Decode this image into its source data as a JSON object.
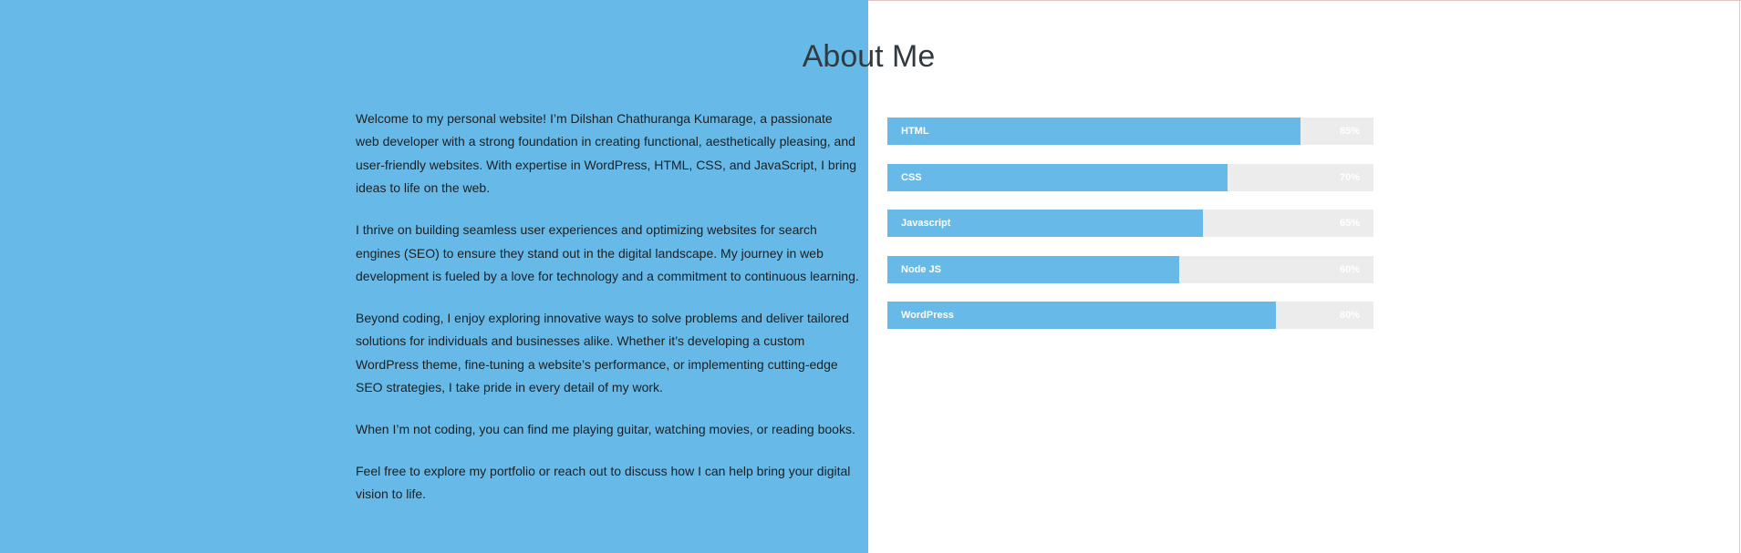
{
  "section": {
    "title": "About Me"
  },
  "bio": {
    "paragraphs": [
      "Welcome to my personal website! I’m Dilshan Chathuranga Kumarage, a passionate web developer with a strong foundation in creating functional, aesthetically pleasing, and user-friendly websites. With expertise in WordPress, HTML, CSS, and JavaScript, I bring ideas to life on the web.",
      "I thrive on building seamless user experiences and optimizing websites for search engines (SEO) to ensure they stand out in the digital landscape. My journey in web development is fueled by a love for technology and a commitment to continuous learning.",
      "Beyond coding, I enjoy exploring innovative ways to solve problems and deliver tailored solutions for individuals and businesses alike. Whether it’s developing a custom WordPress theme, fine-tuning a website’s performance, or implementing cutting-edge SEO strategies, I take pride in every detail of my work.",
      "When I’m not coding, you can find me playing guitar, watching movies, or reading books.",
      "Feel free to explore my portfolio or reach out to discuss how I can help bring your digital vision to life."
    ]
  },
  "skills": [
    {
      "name": "HTML",
      "percent_label": "85%",
      "percent": 85
    },
    {
      "name": "CSS",
      "percent_label": "70%",
      "percent": 70
    },
    {
      "name": "Javascript",
      "percent_label": "65%",
      "percent": 65
    },
    {
      "name": "Node JS",
      "percent_label": "60%",
      "percent": 60
    },
    {
      "name": "WordPress",
      "percent_label": "80%",
      "percent": 80
    }
  ],
  "colors": {
    "accent": "#67bae7",
    "track": "#ececec",
    "text": "#1c1f22",
    "title": "#333a3f"
  }
}
